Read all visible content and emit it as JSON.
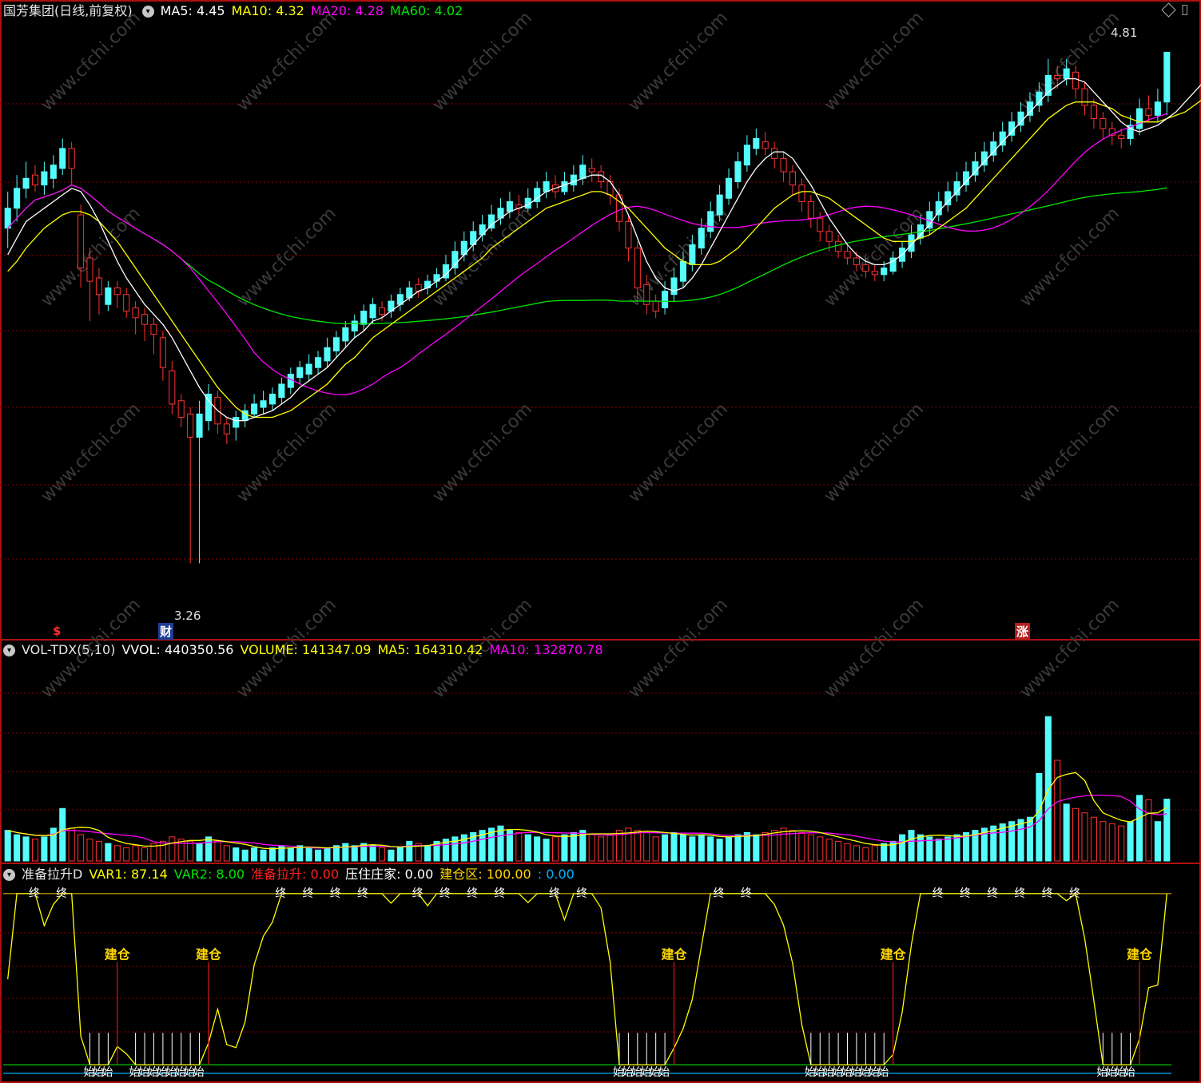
{
  "price_header": {
    "title": "国芳集团(日线,前复权)",
    "ma5": "MA5: 4.45",
    "ma10": "MA10: 4.32",
    "ma20": "MA20: 4.28",
    "ma60": "MA60: 4.02",
    "high_label": "4.81",
    "low_label": "3.26",
    "badge_left": "$",
    "badge_fin": "财",
    "badge_zhang": "涨"
  },
  "volume_header": {
    "name": "VOL-TDX(5,10)",
    "vvol": "VVOL: 440350.56",
    "volume": "VOLUME: 141347.09",
    "ma5": "MA5: 164310.42",
    "ma10": "MA10: 132870.78"
  },
  "indicator_header": {
    "name": "准备拉升D",
    "var1": "VAR1: 87.14",
    "var2": "VAR2: 8.00",
    "zbls": "准备拉升: 0.00",
    "yzzj": "压住庄家: 0.00",
    "jcq": "建仓区: 100.00",
    "last": ": 0.00"
  },
  "markers": {
    "jiancang": "建仓",
    "zhong": "终",
    "shi": "始",
    "watermark": "www.cfchi.com"
  },
  "colors": {
    "up": "#ff3232",
    "down": "#54fcfc",
    "ma5": "#ffffff",
    "ma10": "#ffff00",
    "ma20": "#ff00ff",
    "ma60": "#00e600",
    "ind_line": "#ffff00",
    "grid": "#8b0000",
    "border": "#b01010",
    "line_green": "#00c800",
    "line_cyan": "#00b4ff",
    "line_yellow": "#c8a000",
    "jc_text": "#ffd700"
  },
  "chart_data": {
    "type": "candlestick",
    "price_range": [
      3.1,
      4.9
    ],
    "volume_range": [
      0,
      460000
    ],
    "indicator_range": [
      -6,
      106
    ],
    "candles": [
      [
        4.34,
        4.28,
        4.39,
        4.22,
        70000
      ],
      [
        4.4,
        4.34,
        4.44,
        4.3,
        60000
      ],
      [
        4.43,
        4.4,
        4.48,
        4.37,
        55000
      ],
      [
        4.41,
        4.44,
        4.47,
        4.39,
        50000
      ],
      [
        4.45,
        4.41,
        4.48,
        4.38,
        55000
      ],
      [
        4.47,
        4.43,
        4.5,
        4.4,
        75000
      ],
      [
        4.52,
        4.46,
        4.55,
        4.44,
        120000
      ],
      [
        4.46,
        4.52,
        4.54,
        4.41,
        75000
      ],
      [
        4.16,
        4.32,
        4.35,
        4.1,
        60000
      ],
      [
        4.12,
        4.19,
        4.22,
        4.0,
        50000
      ],
      [
        4.08,
        4.13,
        4.16,
        4.02,
        45000
      ],
      [
        4.1,
        4.05,
        4.12,
        4.03,
        40000
      ],
      [
        4.08,
        4.1,
        4.12,
        4.04,
        35000
      ],
      [
        4.03,
        4.08,
        4.1,
        4.01,
        30000
      ],
      [
        4.01,
        4.04,
        4.06,
        3.96,
        35000
      ],
      [
        3.99,
        4.02,
        4.04,
        3.94,
        30000
      ],
      [
        3.96,
        3.99,
        4.01,
        3.9,
        40000
      ],
      [
        3.86,
        3.95,
        3.97,
        3.82,
        45000
      ],
      [
        3.75,
        3.85,
        3.88,
        3.72,
        55000
      ],
      [
        3.71,
        3.76,
        3.78,
        3.68,
        50000
      ],
      [
        3.65,
        3.72,
        3.74,
        3.27,
        45000
      ],
      [
        3.72,
        3.65,
        3.76,
        3.27,
        40000
      ],
      [
        3.78,
        3.7,
        3.81,
        3.67,
        55000
      ],
      [
        3.69,
        3.77,
        3.79,
        3.66,
        45000
      ],
      [
        3.66,
        3.69,
        3.71,
        3.63,
        35000
      ],
      [
        3.71,
        3.68,
        3.73,
        3.64,
        30000
      ],
      [
        3.73,
        3.7,
        3.75,
        3.68,
        25000
      ],
      [
        3.75,
        3.72,
        3.78,
        3.71,
        30000
      ],
      [
        3.76,
        3.74,
        3.79,
        3.72,
        25000
      ],
      [
        3.78,
        3.75,
        3.8,
        3.73,
        30000
      ],
      [
        3.81,
        3.77,
        3.83,
        3.75,
        35000
      ],
      [
        3.84,
        3.8,
        3.86,
        3.78,
        30000
      ],
      [
        3.86,
        3.83,
        3.88,
        3.81,
        35000
      ],
      [
        3.87,
        3.84,
        3.9,
        3.82,
        30000
      ],
      [
        3.89,
        3.86,
        3.91,
        3.84,
        25000
      ],
      [
        3.92,
        3.88,
        3.95,
        3.86,
        30000
      ],
      [
        3.95,
        3.91,
        3.97,
        3.89,
        35000
      ],
      [
        3.98,
        3.94,
        4.0,
        3.92,
        40000
      ],
      [
        4.0,
        3.97,
        4.02,
        3.95,
        35000
      ],
      [
        4.03,
        3.99,
        4.05,
        3.97,
        40000
      ],
      [
        4.05,
        4.01,
        4.07,
        3.99,
        35000
      ],
      [
        4.02,
        4.04,
        4.06,
        4.0,
        30000
      ],
      [
        4.06,
        4.03,
        4.08,
        4.01,
        25000
      ],
      [
        4.08,
        4.05,
        4.1,
        4.03,
        30000
      ],
      [
        4.1,
        4.07,
        4.12,
        4.06,
        45000
      ],
      [
        4.09,
        4.11,
        4.13,
        4.07,
        40000
      ],
      [
        4.12,
        4.1,
        4.14,
        4.08,
        35000
      ],
      [
        4.14,
        4.12,
        4.16,
        4.1,
        45000
      ],
      [
        4.17,
        4.13,
        4.2,
        4.12,
        50000
      ],
      [
        4.21,
        4.16,
        4.24,
        4.14,
        55000
      ],
      [
        4.24,
        4.2,
        4.27,
        4.18,
        60000
      ],
      [
        4.27,
        4.23,
        4.3,
        4.21,
        65000
      ],
      [
        4.29,
        4.26,
        4.32,
        4.24,
        70000
      ],
      [
        4.32,
        4.28,
        4.35,
        4.27,
        75000
      ],
      [
        4.34,
        4.31,
        4.37,
        4.29,
        80000
      ],
      [
        4.36,
        4.33,
        4.39,
        4.31,
        70000
      ],
      [
        4.34,
        4.35,
        4.38,
        4.32,
        65000
      ],
      [
        4.37,
        4.34,
        4.4,
        4.33,
        60000
      ],
      [
        4.4,
        4.36,
        4.42,
        4.34,
        55000
      ],
      [
        4.42,
        4.39,
        4.45,
        4.37,
        50000
      ],
      [
        4.39,
        4.41,
        4.44,
        4.37,
        55000
      ],
      [
        4.42,
        4.39,
        4.45,
        4.38,
        60000
      ],
      [
        4.44,
        4.41,
        4.47,
        4.39,
        65000
      ],
      [
        4.47,
        4.43,
        4.5,
        4.41,
        70000
      ],
      [
        4.45,
        4.46,
        4.49,
        4.42,
        60000
      ],
      [
        4.42,
        4.45,
        4.47,
        4.4,
        55000
      ],
      [
        4.38,
        4.42,
        4.44,
        4.35,
        60000
      ],
      [
        4.3,
        4.38,
        4.4,
        4.27,
        70000
      ],
      [
        4.22,
        4.3,
        4.32,
        4.18,
        75000
      ],
      [
        4.1,
        4.22,
        4.24,
        4.06,
        70000
      ],
      [
        4.05,
        4.11,
        4.14,
        4.02,
        65000
      ],
      [
        4.03,
        4.06,
        4.08,
        4.01,
        55000
      ],
      [
        4.09,
        4.04,
        4.12,
        4.02,
        60000
      ],
      [
        4.13,
        4.08,
        4.16,
        4.06,
        65000
      ],
      [
        4.18,
        4.12,
        4.21,
        4.1,
        60000
      ],
      [
        4.23,
        4.17,
        4.26,
        4.15,
        55000
      ],
      [
        4.28,
        4.22,
        4.31,
        4.2,
        60000
      ],
      [
        4.33,
        4.27,
        4.36,
        4.25,
        55000
      ],
      [
        4.38,
        4.32,
        4.41,
        4.3,
        50000
      ],
      [
        4.43,
        4.37,
        4.46,
        4.35,
        55000
      ],
      [
        4.48,
        4.42,
        4.51,
        4.4,
        60000
      ],
      [
        4.53,
        4.47,
        4.56,
        4.45,
        65000
      ],
      [
        4.55,
        4.52,
        4.58,
        4.5,
        60000
      ],
      [
        4.52,
        4.54,
        4.57,
        4.5,
        65000
      ],
      [
        4.49,
        4.52,
        4.54,
        4.46,
        70000
      ],
      [
        4.45,
        4.49,
        4.51,
        4.42,
        75000
      ],
      [
        4.41,
        4.45,
        4.47,
        4.38,
        70000
      ],
      [
        4.36,
        4.41,
        4.43,
        4.33,
        65000
      ],
      [
        4.31,
        4.36,
        4.38,
        4.28,
        60000
      ],
      [
        4.27,
        4.31,
        4.33,
        4.24,
        55000
      ],
      [
        4.24,
        4.27,
        4.29,
        4.21,
        50000
      ],
      [
        4.21,
        4.24,
        4.26,
        4.19,
        45000
      ],
      [
        4.19,
        4.21,
        4.23,
        4.17,
        40000
      ],
      [
        4.17,
        4.19,
        4.21,
        4.15,
        35000
      ],
      [
        4.15,
        4.17,
        4.19,
        4.13,
        30000
      ],
      [
        4.14,
        4.15,
        4.17,
        4.12,
        35000
      ],
      [
        4.16,
        4.14,
        4.18,
        4.12,
        40000
      ],
      [
        4.19,
        4.15,
        4.21,
        4.14,
        45000
      ],
      [
        4.22,
        4.18,
        4.24,
        4.16,
        60000
      ],
      [
        4.26,
        4.21,
        4.29,
        4.19,
        70000
      ],
      [
        4.29,
        4.25,
        4.32,
        4.23,
        60000
      ],
      [
        4.33,
        4.28,
        4.36,
        4.26,
        55000
      ],
      [
        4.36,
        4.32,
        4.39,
        4.3,
        50000
      ],
      [
        4.39,
        4.35,
        4.42,
        4.33,
        55000
      ],
      [
        4.42,
        4.38,
        4.45,
        4.36,
        60000
      ],
      [
        4.45,
        4.41,
        4.48,
        4.39,
        65000
      ],
      [
        4.48,
        4.44,
        4.51,
        4.42,
        70000
      ],
      [
        4.51,
        4.47,
        4.54,
        4.45,
        75000
      ],
      [
        4.54,
        4.5,
        4.57,
        4.48,
        80000
      ],
      [
        4.57,
        4.53,
        4.6,
        4.51,
        85000
      ],
      [
        4.6,
        4.56,
        4.63,
        4.54,
        90000
      ],
      [
        4.63,
        4.59,
        4.66,
        4.57,
        95000
      ],
      [
        4.66,
        4.62,
        4.69,
        4.6,
        100000
      ],
      [
        4.69,
        4.65,
        4.72,
        4.63,
        200000
      ],
      [
        4.74,
        4.68,
        4.79,
        4.66,
        330000
      ],
      [
        4.73,
        4.74,
        4.77,
        4.7,
        230000
      ],
      [
        4.76,
        4.73,
        4.79,
        4.71,
        130000
      ],
      [
        4.7,
        4.75,
        4.77,
        4.67,
        120000
      ],
      [
        4.65,
        4.7,
        4.72,
        4.62,
        110000
      ],
      [
        4.61,
        4.65,
        4.67,
        4.58,
        100000
      ],
      [
        4.58,
        4.61,
        4.63,
        4.55,
        90000
      ],
      [
        4.56,
        4.58,
        4.6,
        4.53,
        85000
      ],
      [
        4.55,
        4.56,
        4.58,
        4.52,
        80000
      ],
      [
        4.59,
        4.55,
        4.62,
        4.53,
        90000
      ],
      [
        4.64,
        4.58,
        4.67,
        4.56,
        150000
      ],
      [
        4.62,
        4.64,
        4.68,
        4.6,
        140000
      ],
      [
        4.66,
        4.62,
        4.7,
        4.6,
        90000
      ],
      [
        4.81,
        4.66,
        4.81,
        4.62,
        141347
      ]
    ],
    "ma5": [
      4.2,
      4.25,
      4.3,
      4.32,
      4.34,
      4.36,
      4.38,
      4.4,
      4.39,
      4.35,
      4.3,
      4.24,
      4.18,
      4.13,
      4.09,
      4.05,
      4.02,
      3.99,
      3.95,
      3.9,
      3.85,
      3.8,
      3.76,
      3.73,
      3.71,
      3.7,
      3.7,
      3.71,
      3.72,
      3.73,
      3.75,
      3.77,
      3.8,
      3.82,
      3.84,
      3.86,
      3.89,
      3.92,
      3.95,
      3.97,
      4.0,
      4.01,
      4.03,
      4.05,
      4.07,
      4.09,
      4.1,
      4.12,
      4.14,
      4.17,
      4.2,
      4.23,
      4.26,
      4.29,
      4.31,
      4.33,
      4.34,
      4.35,
      4.37,
      4.39,
      4.4,
      4.41,
      4.42,
      4.43,
      4.44,
      4.44,
      4.42,
      4.38,
      4.32,
      4.25,
      4.18,
      4.13,
      4.1,
      4.09,
      4.1,
      4.13,
      4.17,
      4.22,
      4.27,
      4.32,
      4.37,
      4.42,
      4.46,
      4.49,
      4.51,
      4.51,
      4.49,
      4.45,
      4.41,
      4.36,
      4.31,
      4.27,
      4.23,
      4.2,
      4.18,
      4.17,
      4.17,
      4.18,
      4.2,
      4.23,
      4.26,
      4.29,
      4.33,
      4.36,
      4.39,
      4.42,
      4.45,
      4.48,
      4.51,
      4.54,
      4.57,
      4.6,
      4.63,
      4.66,
      4.69,
      4.71,
      4.73,
      4.73,
      4.72,
      4.69,
      4.66,
      4.63,
      4.6,
      4.58,
      4.57,
      4.58,
      4.59,
      4.61,
      4.63,
      4.66,
      4.69,
      4.72,
      4.74,
      4.76
    ],
    "ma10": [
      4.15,
      4.18,
      4.22,
      4.25,
      4.28,
      4.3,
      4.32,
      4.33,
      4.33,
      4.32,
      4.3,
      4.27,
      4.24,
      4.2,
      4.16,
      4.12,
      4.08,
      4.04,
      4.0,
      3.96,
      3.92,
      3.88,
      3.84,
      3.8,
      3.77,
      3.74,
      3.72,
      3.71,
      3.71,
      3.71,
      3.72,
      3.73,
      3.75,
      3.77,
      3.79,
      3.81,
      3.84,
      3.87,
      3.89,
      3.92,
      3.95,
      3.97,
      3.99,
      4.01,
      4.03,
      4.05,
      4.07,
      4.09,
      4.11,
      4.13,
      4.15,
      4.17,
      4.19,
      4.22,
      4.24,
      4.26,
      4.28,
      4.3,
      4.32,
      4.34,
      4.35,
      4.36,
      4.37,
      4.38,
      4.39,
      4.39,
      4.38,
      4.36,
      4.34,
      4.31,
      4.28,
      4.25,
      4.22,
      4.2,
      4.18,
      4.17,
      4.17,
      4.17,
      4.18,
      4.2,
      4.22,
      4.25,
      4.28,
      4.31,
      4.34,
      4.36,
      4.38,
      4.39,
      4.39,
      4.38,
      4.37,
      4.35,
      4.33,
      4.31,
      4.29,
      4.27,
      4.25,
      4.24,
      4.24,
      4.24,
      4.25,
      4.26,
      4.28,
      4.3,
      4.32,
      4.34,
      4.37,
      4.4,
      4.43,
      4.46,
      4.49,
      4.52,
      4.55,
      4.58,
      4.61,
      4.63,
      4.65,
      4.66,
      4.66,
      4.66,
      4.65,
      4.64,
      4.62,
      4.61,
      4.6,
      4.6,
      4.6,
      4.61,
      4.62,
      4.63,
      4.65,
      4.67,
      4.69,
      4.71
    ]
  }
}
